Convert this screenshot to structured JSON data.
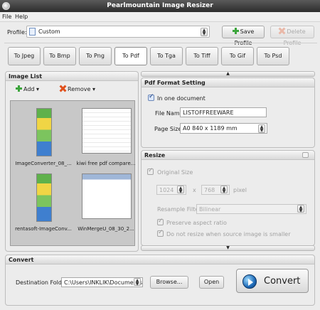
{
  "window": {
    "title": "Pearlmountain Image Resizer"
  },
  "menu": {
    "file": "File",
    "help": "Help"
  },
  "profile": {
    "label": "Profile:",
    "value": "Custom",
    "save_label": "Save Profile",
    "delete_label": "Delete Profile"
  },
  "formats": [
    "To Jpeg",
    "To Bmp",
    "To Png",
    "To Pdf",
    "To Tga",
    "To Tiff",
    "To Gif",
    "To Psd"
  ],
  "active_format": "To Pdf",
  "image_list": {
    "title": "Image List",
    "add_label": "Add",
    "remove_label": "Remove",
    "items": [
      {
        "caption": "ImageConverter_08_..."
      },
      {
        "caption": "kiwi free pdf compare..."
      },
      {
        "caption": "rentasoft-ImageConv..."
      },
      {
        "caption": "WinMergeU_08_30_2..."
      }
    ]
  },
  "pdf_settings": {
    "title": "Pdf Format Setting",
    "one_document_label": "In one document",
    "one_document_checked": true,
    "file_name_label": "File Name:",
    "file_name_value": "LISTOFFREEWARE",
    "page_size_label": "Page Size:",
    "page_size_value": "A0 840 x 1189 mm"
  },
  "resize": {
    "title": "Resize",
    "original_size_label": "Original Size",
    "width_value": "1024",
    "times_label": "x",
    "height_value": "768",
    "unit_value": "pixel",
    "resample_label": "Resample Filter:",
    "resample_value": "Bilinear",
    "preserve_label": "Preserve aspect ratio",
    "no_small_label": "Do not resize when source image is smaller"
  },
  "convert": {
    "title": "Convert",
    "dest_label": "Destination Folder:",
    "dest_value": "C:\\Users\\INKLIK\\Documents",
    "browse_label": "Browse...",
    "open_label": "Open",
    "convert_label": "Convert"
  },
  "colors": {
    "accent_green": "#3ca53c",
    "remove_red": "#e0501c",
    "convert_blue": "#1f6bb8"
  }
}
